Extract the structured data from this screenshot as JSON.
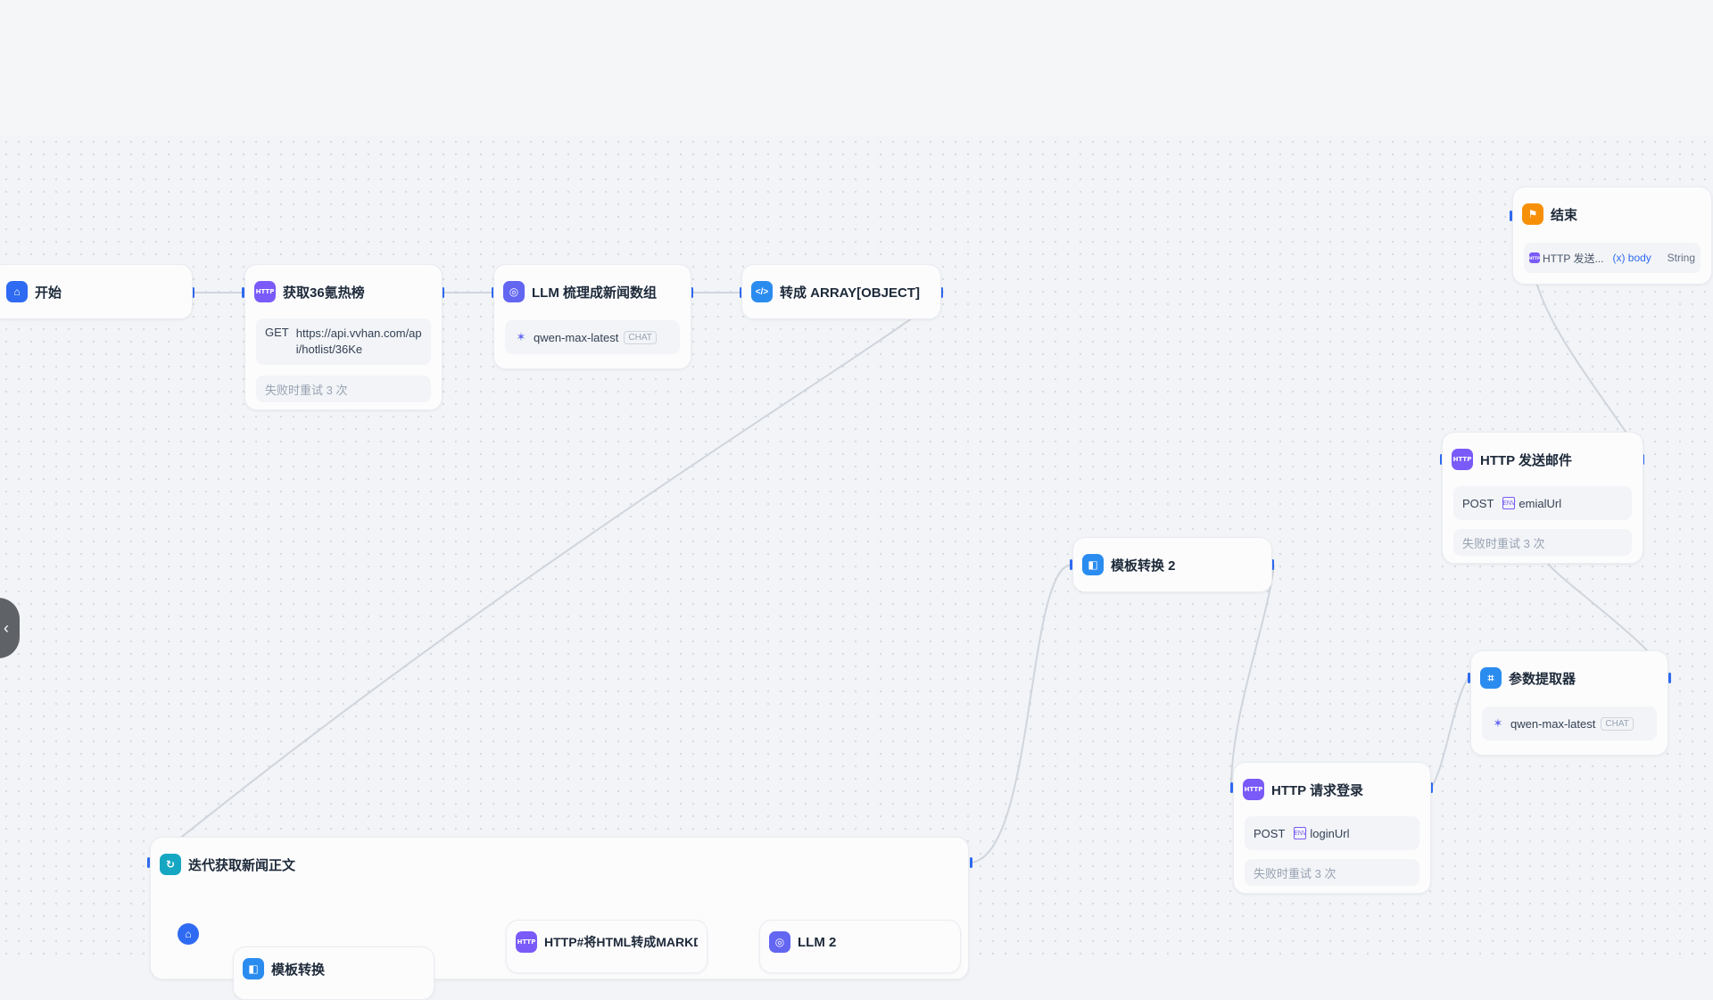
{
  "nodes": {
    "start": {
      "title": "开始"
    },
    "fetch36": {
      "title": "获取36氪热榜",
      "method": "GET",
      "url": "https://api.vvhan.com/api/hotlist/36Ke",
      "retry": "失败时重试 3 次"
    },
    "llm_sort": {
      "title": "LLM 梳理成新闻数组",
      "model": "qwen-max-latest",
      "mode": "CHAT"
    },
    "to_array": {
      "title": "转成 ARRAY[OBJECT]"
    },
    "end": {
      "title": "结束",
      "var_source": "HTTP 发送...",
      "var_name": "(x) body",
      "var_type": "String"
    },
    "http_email": {
      "title": "HTTP 发送邮件",
      "method": "POST",
      "var": "emialUrl",
      "retry": "失败时重试 3 次"
    },
    "template2": {
      "title": "模板转换 2"
    },
    "param_extract": {
      "title": "参数提取器",
      "model": "qwen-max-latest",
      "mode": "CHAT"
    },
    "http_login": {
      "title": "HTTP 请求登录",
      "method": "POST",
      "var": "loginUrl",
      "retry": "失败时重试 3 次"
    },
    "iteration": {
      "title": "迭代获取新闻正文"
    },
    "inner_template": {
      "title": "模板转换"
    },
    "inner_http": {
      "title": "HTTP#将HTML转成MARKDOWN"
    },
    "inner_llm2": {
      "title": "LLM 2"
    }
  },
  "icons": {
    "start": "home-icon",
    "http": "http-icon",
    "llm": "llm-icon",
    "code": "code-icon",
    "end": "flag-icon",
    "template": "template-icon",
    "extract": "extractor-icon",
    "iteration": "loop-icon",
    "model": "model-spark-icon",
    "env": "env-variable-icon",
    "collapse": "chevron-left-icon"
  },
  "colors": {
    "canvas": "#f2f4f7",
    "accent": "#2f6bf2",
    "http": "#7a5af8",
    "end": "#f79009",
    "iteration": "#15a7c2"
  },
  "http_badge": "HTTP",
  "env_badge": "ENV",
  "collapse_glyph": "‹"
}
